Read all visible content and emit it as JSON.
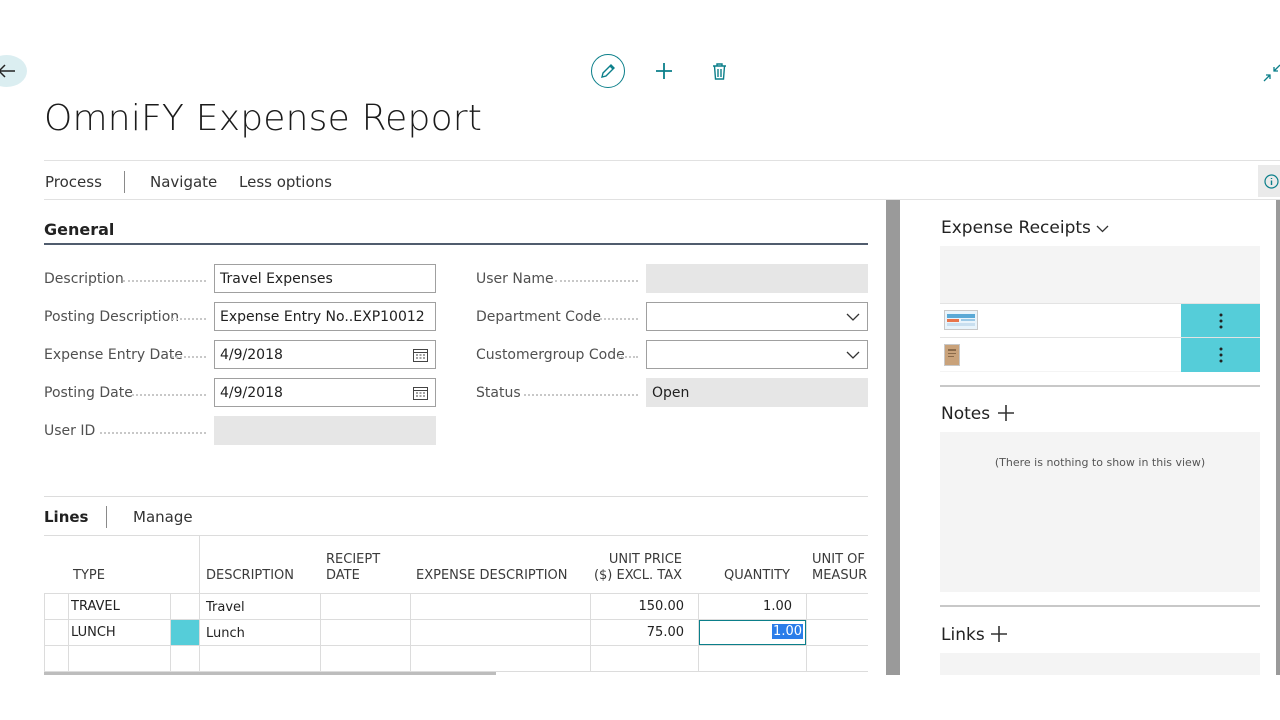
{
  "page": {
    "title": "OmniFY Expense Report"
  },
  "actions": {
    "process": "Process",
    "navigate": "Navigate",
    "less_options": "Less options"
  },
  "general": {
    "title": "General",
    "description": {
      "label": "Description",
      "value": "Travel Expenses"
    },
    "posting_description": {
      "label": "Posting Description",
      "value": "Expense Entry No..EXP10012"
    },
    "expense_entry_date": {
      "label": "Expense Entry Date",
      "value": "4/9/2018"
    },
    "posting_date": {
      "label": "Posting Date",
      "value": "4/9/2018"
    },
    "user_id": {
      "label": "User ID",
      "value": ""
    },
    "user_name": {
      "label": "User Name",
      "value": ""
    },
    "department_code": {
      "label": "Department Code",
      "value": ""
    },
    "customergroup_code": {
      "label": "Customergroup Code",
      "value": ""
    },
    "status": {
      "label": "Status",
      "value": "Open"
    }
  },
  "lines": {
    "title": "Lines",
    "manage": "Manage",
    "headers": {
      "type": "TYPE",
      "description": "DESCRIPTION",
      "receipt_date_1": "RECIEPT",
      "receipt_date_2": "DATE",
      "expense_description": "EXPENSE DESCRIPTION",
      "unit_price_1": "UNIT PRICE",
      "unit_price_2": "($) EXCL. TAX",
      "quantity": "QUANTITY",
      "uom_1": "UNIT OF",
      "uom_2": "MEASUR"
    },
    "rows": [
      {
        "type": "TRAVEL",
        "description": "Travel",
        "receipt_date": "",
        "expense_description": "",
        "unit_price": "150.00",
        "quantity": "1.00"
      },
      {
        "type": "LUNCH",
        "description": "Lunch",
        "receipt_date": "",
        "expense_description": "",
        "unit_price": "75.00",
        "quantity": "1.00"
      }
    ]
  },
  "factbox": {
    "receipts_title": "Expense Receipts",
    "notes_title": "Notes",
    "notes_empty": "(There is nothing to show in this view)",
    "links_title": "Links"
  },
  "colors": {
    "accent": "#0b7f8a",
    "row_menu": "#55cdd9",
    "selection": "#2b7de9"
  }
}
